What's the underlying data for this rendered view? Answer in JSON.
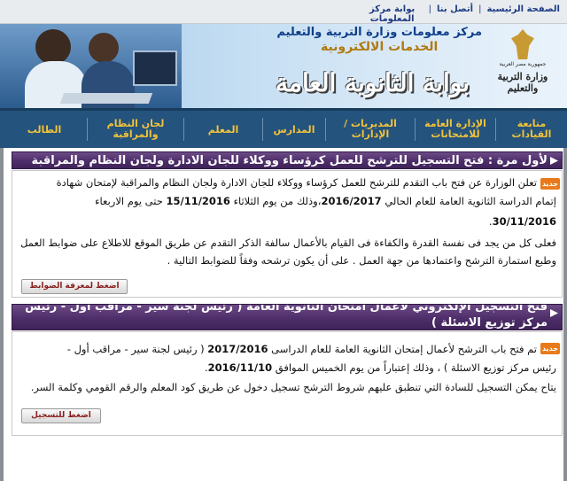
{
  "topbar": {
    "links": [
      {
        "label": "الصفحة الرئيسية"
      },
      {
        "label": "أتصل بنا"
      },
      {
        "label": "بوابة مركز المعلومات"
      }
    ],
    "sep": "|"
  },
  "banner": {
    "line1": "مركز معلومات وزارة التربية والتعليم",
    "line2": "الخدمات الالكترونية",
    "title": "بوابة الثانوية العامة",
    "logo_sub": "جمهورية مصر العربية",
    "logo_script": "وزارة التربية والتعليم"
  },
  "nav": {
    "items": [
      {
        "label": "متابعة القيادات"
      },
      {
        "label": "الإدارة العامة للامتحانات"
      },
      {
        "label": "المديريات / الإدارات"
      },
      {
        "label": "المدارس"
      },
      {
        "label": "المعلم"
      },
      {
        "label": "لجان النظام والمراقبة"
      },
      {
        "label": "الطالب"
      }
    ]
  },
  "announcement1": {
    "title": "لأول مرة : فتح التسجيل للترشح للعمل كرؤساء ووكلاء للجان الادارة ولجان النظام والمراقبة",
    "new_tag": "جديد",
    "line1": "تعلن الوزارة عن فتح باب التقدم للترشح للعمل كرؤساء ووكلاء للجان الادارة ولجان النظام والمراقبة لإمتحان شهادة",
    "line2a": "إتمام الدراسة الثانوية العامة للعام الحالي",
    "line2b": "2016/2017",
    "line2c": "،وذلك من يوم الثلاثاء",
    "line2d": "15/11/2016",
    "line2e": "حتى يوم الاربعاء",
    "line3": "30/11/2016",
    "line3b": ".",
    "line4": "فعلى كل من يجد فى نفسة القدرة والكفاءة فى القيام بالأعمال سالفة الذكر التقدم عن طريق الموقع للاطلاع على ضوابط العمل",
    "line5": "وطبع استمارة الترشح واعتمادها من جهة العمل . على أن يكون ترشحه وفقاً للضوابط التالية .",
    "button": "اضغط لمعرفة الضوابط"
  },
  "announcement2": {
    "title": "فتح التسجيل الإلكتروني لأعمال امتحان الثانوية العامة ( رئيس لجنة سير - مراقب أول - رئيس مركز توزيع الاسئلة )",
    "new_tag": "جديد",
    "line1a": "تم فتح باب الترشح لأعمال إمتحان الثانوية العامة للعام الدراسى",
    "line1b": "2017/2016",
    "line1c": "( رئيس لجنة سير - مراقب أول -",
    "line2a": "رئيس مركز توزيع الاسئلة ) ، وذلك إعتباراً من يوم الخميس الموافق",
    "line2b": "2016/11/10",
    "line2c": ".",
    "line3": "يتاح يمكن التسجيل للسادة التي تنطبق عليهم شروط الترشح تسجيل دخول عن طريق كود المعلم والرقم القومي وكلمة السر.",
    "button": "اضغط للتسجيل"
  }
}
